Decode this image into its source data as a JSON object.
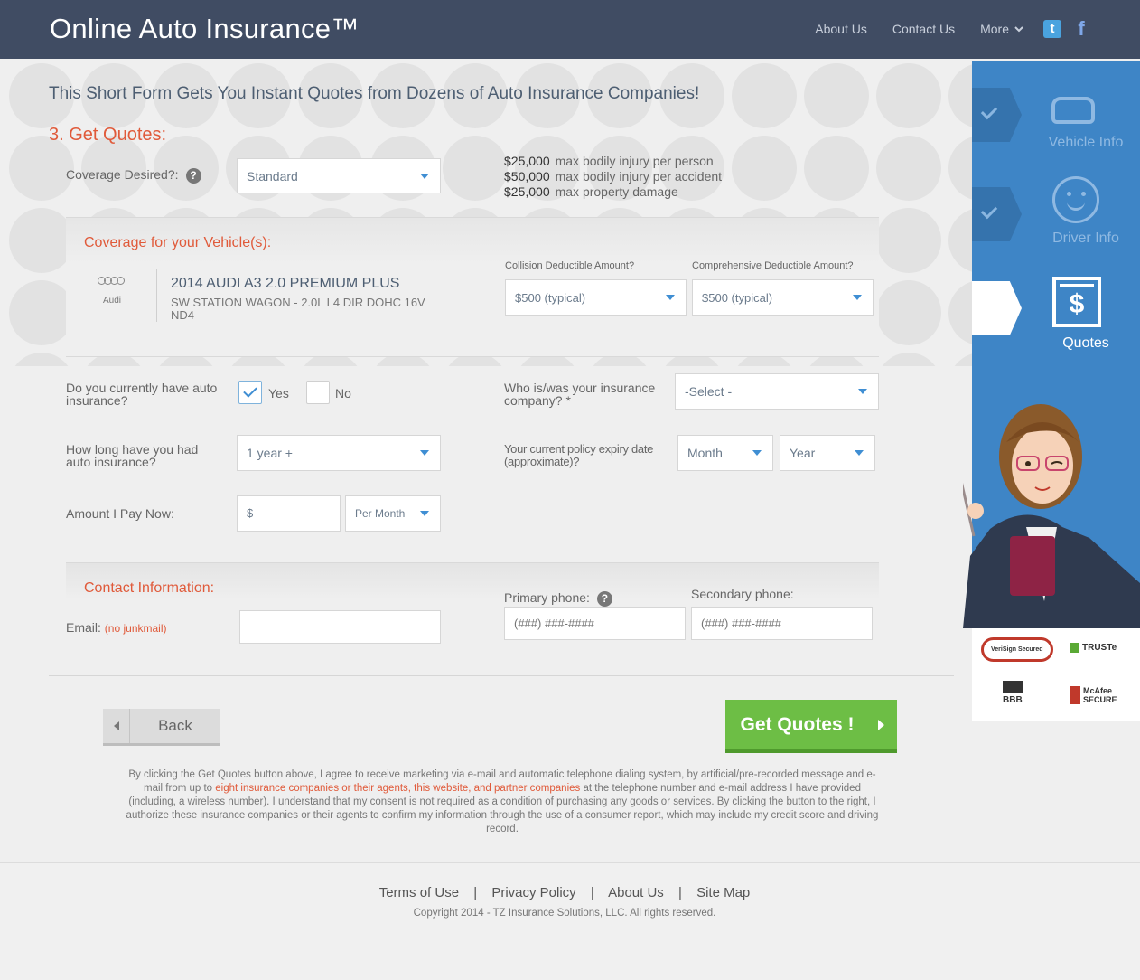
{
  "header": {
    "brand": "Online Auto Insurance™",
    "nav": [
      "About Us",
      "Contact Us",
      "More"
    ],
    "twitter_glyph": "t",
    "facebook_glyph": "f"
  },
  "main": {
    "title": "This Short Form Gets You Instant Quotes from Dozens of Auto Insurance Companies!",
    "step_title": "3. Get Quotes:",
    "coverage": {
      "label": "Coverage Desired?:",
      "help": "?",
      "value": "Standard",
      "limits": [
        {
          "amount": "$25,000",
          "text": "max bodily injury per person"
        },
        {
          "amount": "$50,000",
          "text": "max bodily injury per accident"
        },
        {
          "amount": "$25,000",
          "text": "max property damage"
        }
      ]
    },
    "vehicle_section": {
      "title": "Coverage for your Vehicle(s):",
      "make": "Audi",
      "name": "2014 AUDI A3 2.0 PREMIUM PLUS",
      "desc": "SW STATION WAGON - 2.0L L4 DIR DOHC 16V ND4",
      "collision_label": "Collision Deductible Amount?",
      "collision_value": "$500 (typical)",
      "comprehensive_label": "Comprehensive Deductible Amount?",
      "comprehensive_value": "$500 (typical)"
    },
    "insurance": {
      "current_label": "Do you currently have auto insurance?",
      "yes": "Yes",
      "no": "No",
      "company_label": "Who is/was your insurance company? *",
      "company_value": "-Select -",
      "how_long_label": "How long have you had auto insurance?",
      "how_long_value": "1 year +",
      "expiry_label": "Your current policy expiry date (approximate)?",
      "month_value": "Month",
      "year_value": "Year",
      "amount_label": "Amount I Pay Now:",
      "amount_prefix": "$",
      "period_value": "Per Month"
    },
    "contact": {
      "title": "Contact Information:",
      "email_label": "Email:",
      "email_note": "(no junkmail)",
      "primary_label": "Primary phone:",
      "primary_help": "?",
      "primary_placeholder": "(###) ###-####",
      "secondary_label": "Secondary phone:",
      "secondary_placeholder": "(###) ###-####"
    },
    "back": "Back",
    "submit": "Get Quotes !",
    "legal_1": "By clicking the Get Quotes button above, I agree to receive marketing via e-mail and automatic telephone dialing system, by artificial/pre-recorded message and e-mail from up to ",
    "legal_link": "eight insurance companies or their agents, this website, and partner companies",
    "legal_2": " at the telephone number and e-mail address I have provided (including, a wireless number). I understand that my consent is not required as a condition of purchasing any goods or services. By clicking the button to the right, I authorize these insurance companies or their agents to confirm my information through the use of a consumer report, which may include my credit score and driving record."
  },
  "sidebar": {
    "steps": [
      "Vehicle Info",
      "Driver Info",
      "Quotes"
    ],
    "quote_glyph": "$",
    "badges": [
      "VeriSign Secured",
      "TRUSTe",
      "BBB",
      "McAfee SECURE"
    ]
  },
  "footer": {
    "links": [
      "Terms of Use",
      "Privacy Policy",
      "About Us",
      "Site Map"
    ],
    "separator": "|",
    "copyright": "Copyright 2014 - TZ Insurance Solutions, LLC. All rights reserved."
  }
}
